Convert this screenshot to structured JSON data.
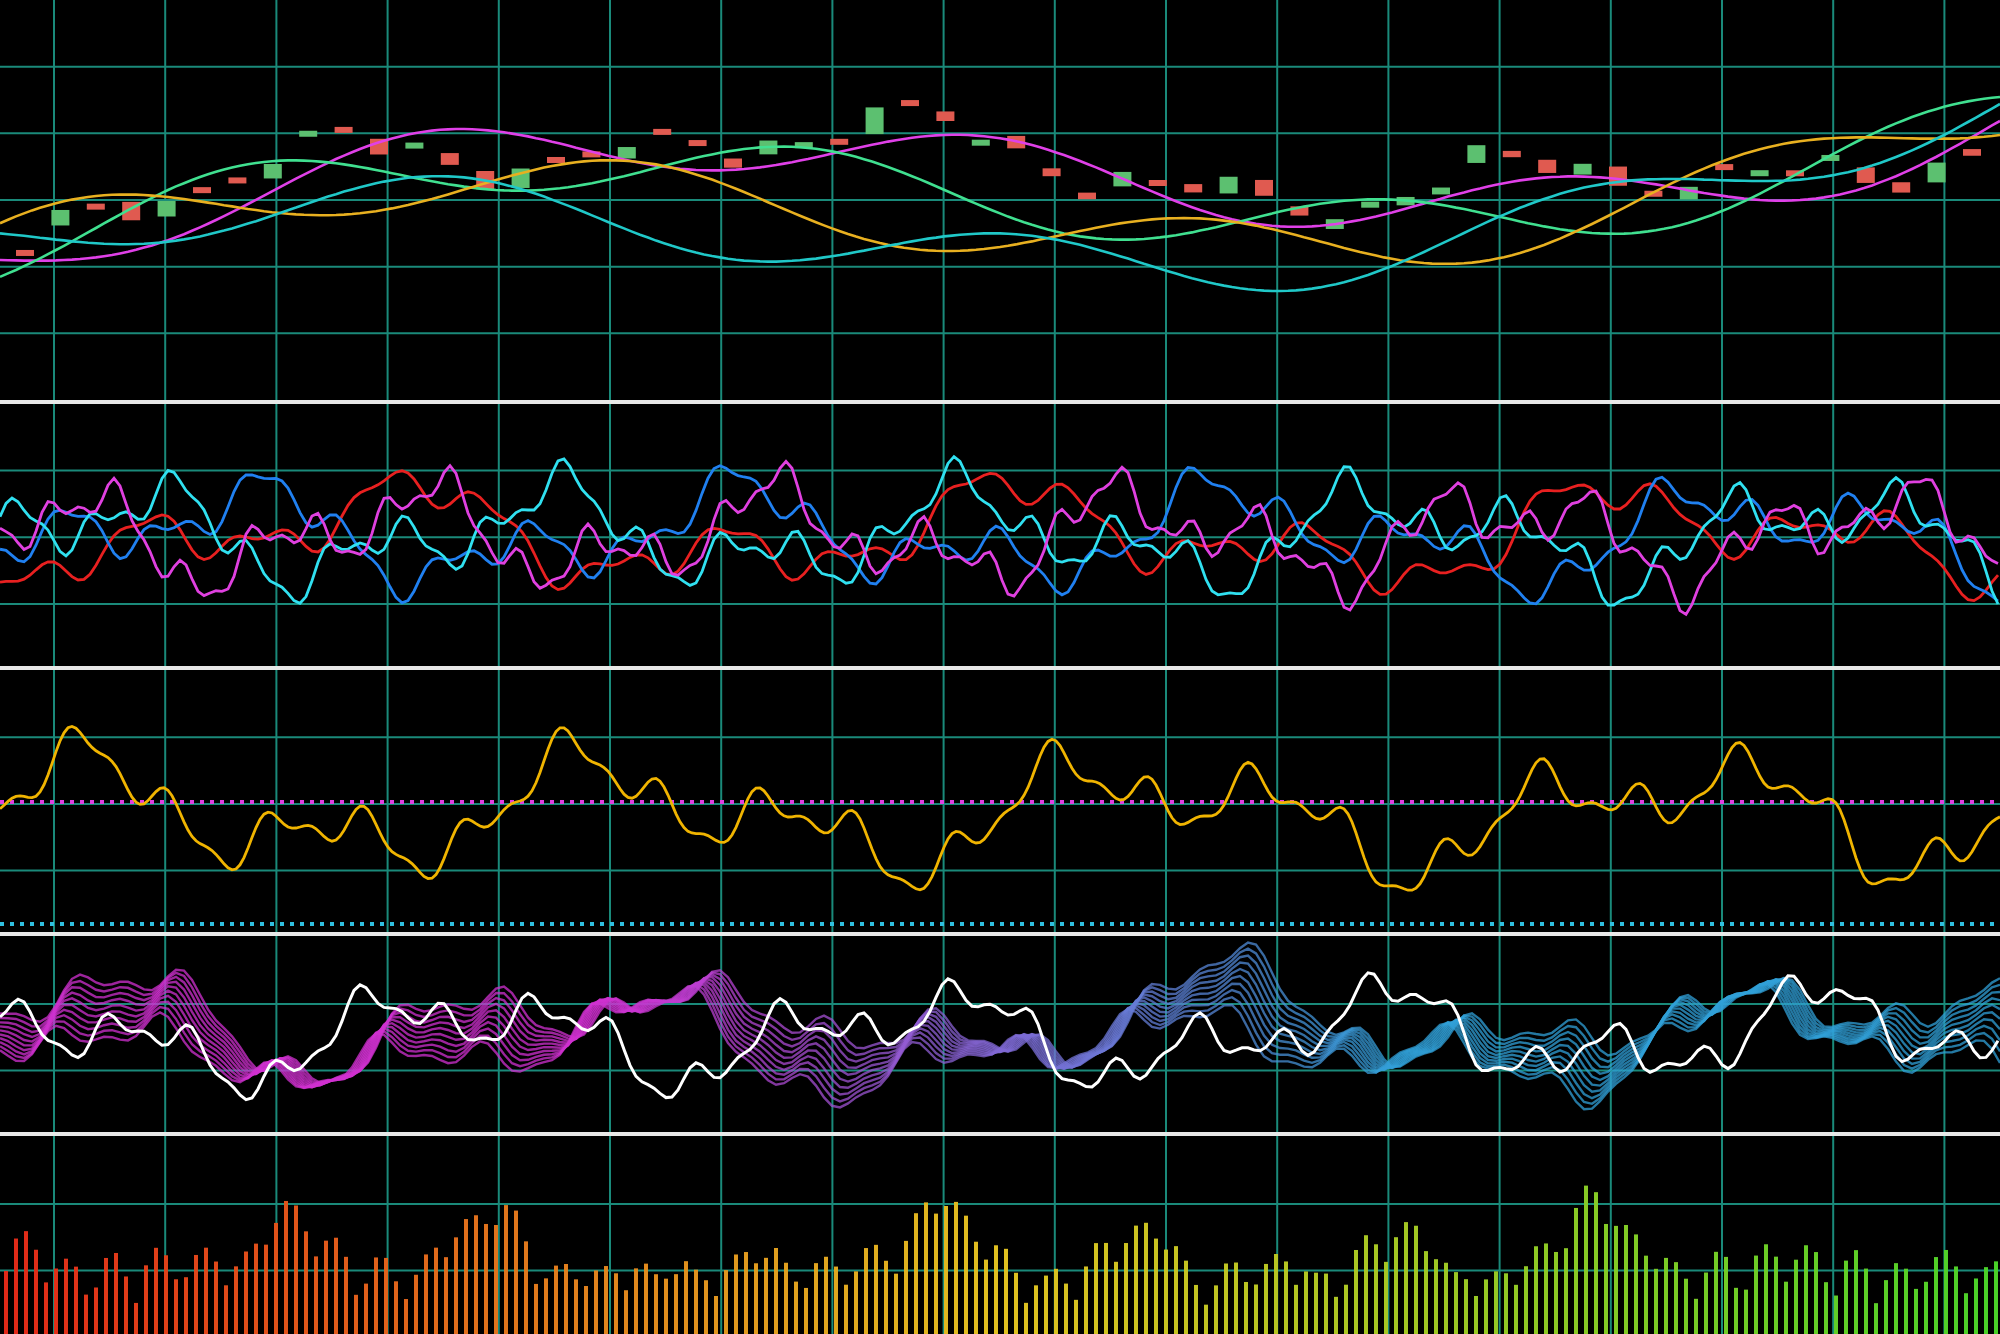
{
  "panels": [
    {
      "kind": "candlestick",
      "series": [
        {
          "color": "#e040e8"
        },
        {
          "color": "#40e090"
        },
        {
          "color": "#e8b020"
        },
        {
          "color": "#20c8c8"
        }
      ]
    },
    {
      "kind": "lines",
      "series": [
        {
          "color": "#e82020"
        },
        {
          "color": "#2080f0"
        },
        {
          "color": "#30e0f0"
        },
        {
          "color": "#e040e0"
        }
      ]
    },
    {
      "kind": "oscillator",
      "series": [
        {
          "color": "#f0b400"
        },
        {
          "color": "#e040e0"
        },
        {
          "color": "#30c0e0"
        }
      ]
    },
    {
      "kind": "wave",
      "series": [
        {
          "color": "#d030d0"
        },
        {
          "color": "#30a0d8"
        },
        {
          "color": "#ffffff"
        }
      ]
    },
    {
      "kind": "histogram",
      "series": [
        {
          "color": "#e02818"
        },
        {
          "color": "#e0c020"
        },
        {
          "color": "#48d028"
        }
      ]
    }
  ]
}
